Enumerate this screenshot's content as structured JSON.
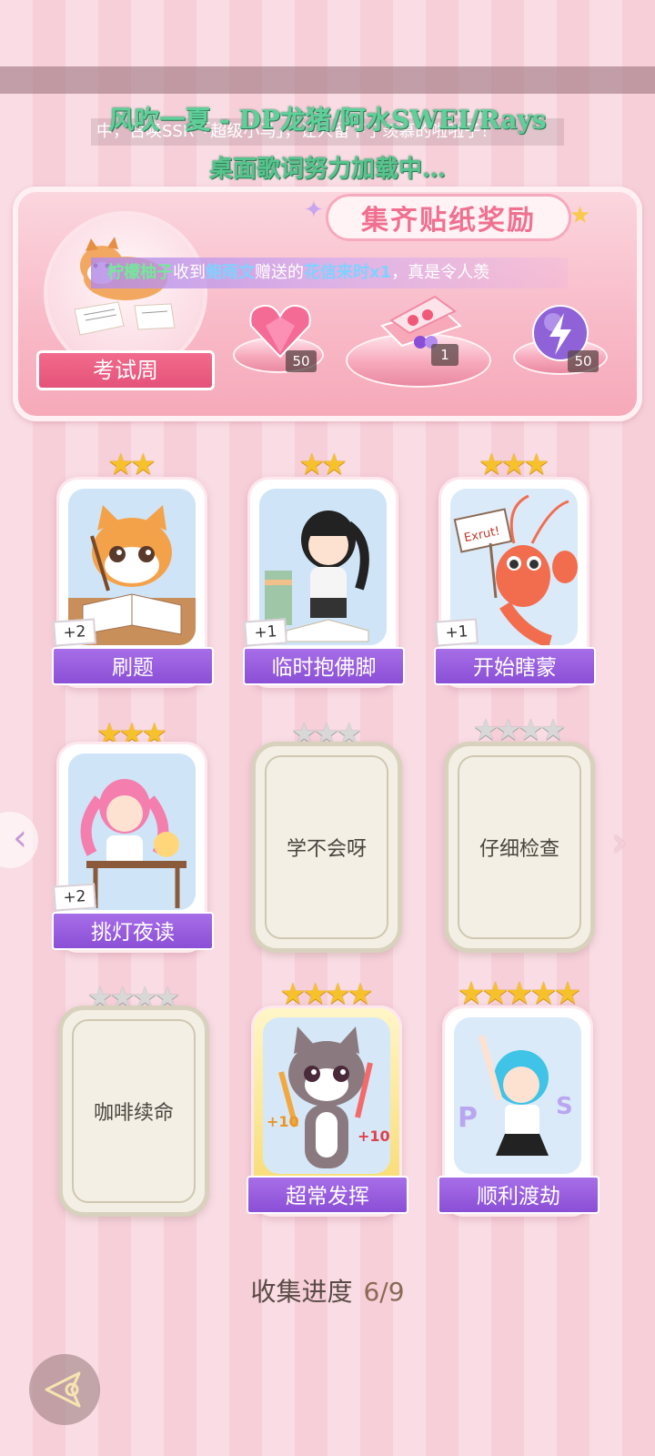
{
  "ticker_text": "中，召唤SSR「超级小马」，让人留下了羡慕的啦啦子！",
  "lyrics": {
    "line1": "风吹一夏 - DP龙猪/阿水SWEI/Rays",
    "line2": "桌面歌词努力加载中…"
  },
  "banner": {
    "title": "集齐贴纸奖励",
    "circle_label": "考试周",
    "rewards": [
      {
        "icon": "heart-gem-icon",
        "count": "50"
      },
      {
        "icon": "gift-box-icon",
        "count": "1"
      },
      {
        "icon": "lightning-orb-icon",
        "count": "50"
      }
    ]
  },
  "notice": {
    "user": "柠檬柚子",
    "text1": "收到",
    "sender": "鲍雨文",
    "text2": "赠送的",
    "gift": "花信来时x1",
    "text3": "，真是令人羡"
  },
  "cards": [
    {
      "name": "刷题",
      "stars": "★★",
      "plus": "+2",
      "unlocked": true
    },
    {
      "name": "临时抱佛脚",
      "stars": "★★",
      "plus": "+1",
      "unlocked": true
    },
    {
      "name": "开始瞎蒙",
      "stars": "★★★",
      "plus": "+1",
      "unlocked": true
    },
    {
      "name": "挑灯夜读",
      "stars": "★★★",
      "plus": "+2",
      "unlocked": true
    },
    {
      "name": "学不会呀",
      "stars": "★★★",
      "unlocked": false
    },
    {
      "name": "仔细检查",
      "stars": "★★★★",
      "unlocked": false
    },
    {
      "name": "咖啡续命",
      "stars": "★★★★",
      "unlocked": false
    },
    {
      "name": "超常发挥",
      "stars": "★★★★",
      "unlocked": true
    },
    {
      "name": "顺利渡劫",
      "stars": "★★★★★",
      "unlocked": true
    }
  ],
  "art_text": {
    "lobster_sign": "Exrut!",
    "cat_plus1": "+10",
    "cat_plus2": "+10"
  },
  "progress": {
    "label": "收集进度",
    "value": "6/9",
    "collected": 6,
    "total": 9
  },
  "nav": {
    "left_arrow": "‹",
    "right_arrow": "›"
  }
}
